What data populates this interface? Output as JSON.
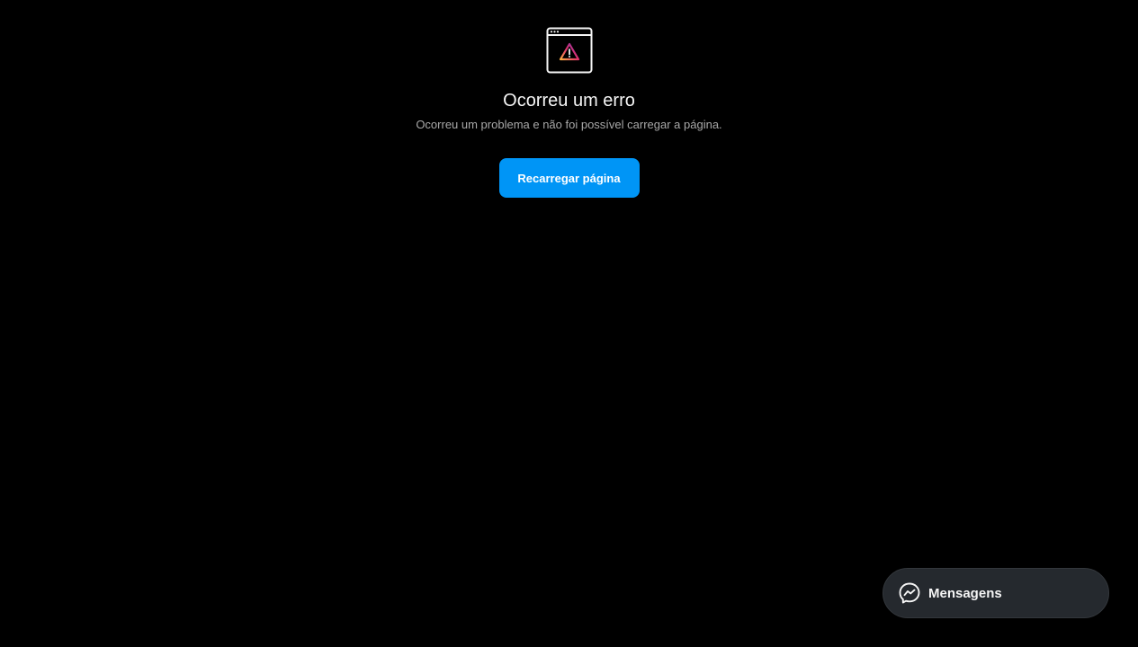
{
  "error": {
    "icon": "browser-window-warning-icon",
    "title": "Ocorreu um erro",
    "description": "Ocorreu um problema e não foi possível carregar a página.",
    "reload_label": "Recarregar página"
  },
  "messages": {
    "icon": "messenger-icon",
    "label": "Mensagens"
  },
  "colors": {
    "background": "#000000",
    "primary_button": "#0095f6",
    "pill_background": "#25292e",
    "secondary_text": "#a8a8a8",
    "gradient_start": "#fcaf45",
    "gradient_mid": "#e1306c",
    "gradient_end": "#833ab4"
  }
}
